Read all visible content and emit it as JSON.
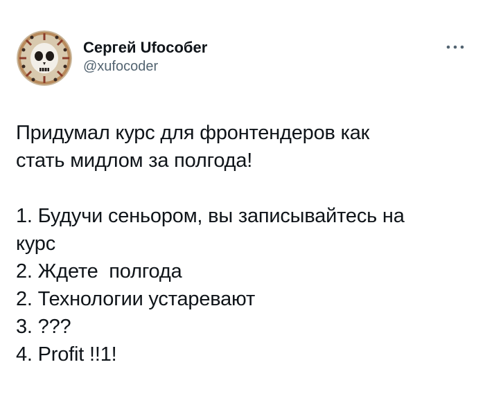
{
  "author": {
    "display_name": "Сергей Ufocoбer",
    "handle": "@xufocoder",
    "avatar_icon": "skull-mask-icon"
  },
  "more_icon": "more-options-icon",
  "tweet": {
    "lines": [
      "Придумал курс для фронтендеров как",
      "стать мидлом за полгода!",
      "",
      "1. Будучи сеньором, вы записывайтесь на",
      "курс",
      "2. Ждете  полгода",
      "2. Технологии устаревают",
      "3. ???",
      "4. Profit !!1!"
    ]
  },
  "colors": {
    "text": "#0f1419",
    "secondary": "#536471",
    "background": "#ffffff"
  }
}
